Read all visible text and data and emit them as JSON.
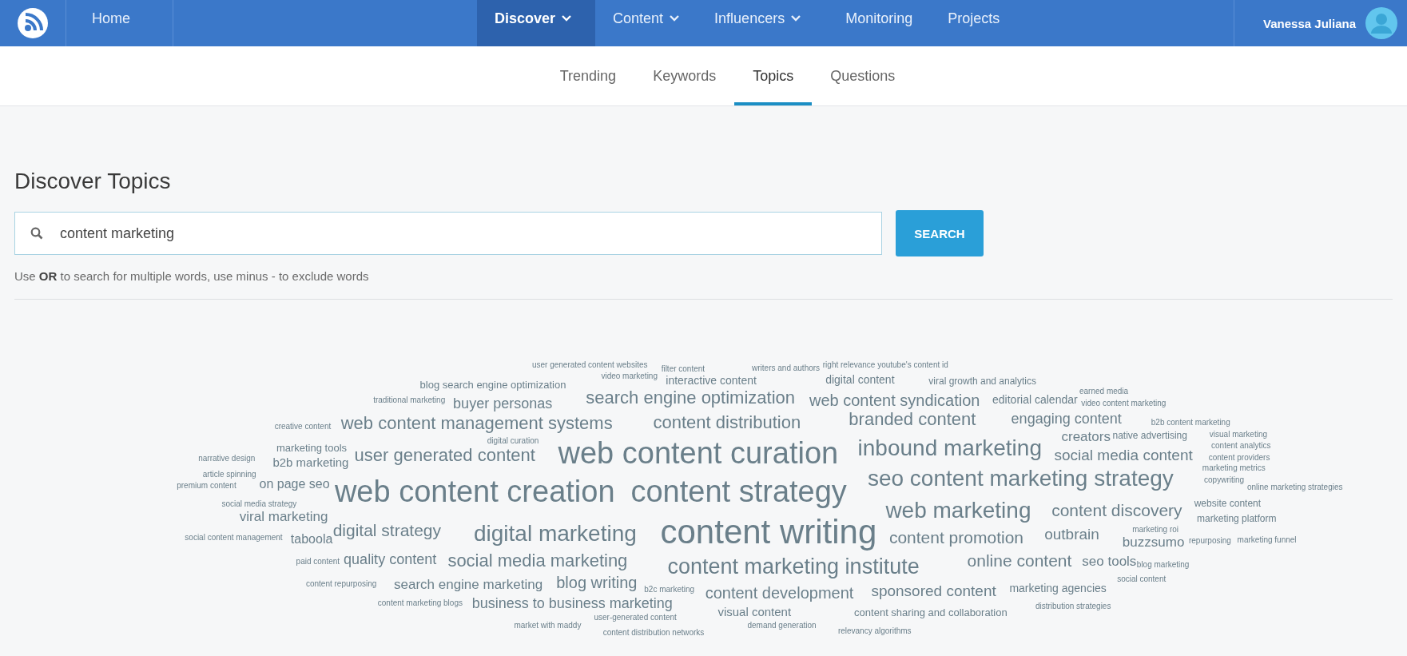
{
  "top_nav": {
    "home": {
      "label": "Home"
    },
    "items": [
      {
        "label": "Discover",
        "selected": true,
        "has_menu": true
      },
      {
        "label": "Content",
        "selected": false,
        "has_menu": true
      },
      {
        "label": "Influencers",
        "selected": false,
        "has_menu": true
      },
      {
        "label": "Monitoring",
        "selected": false,
        "has_menu": false
      },
      {
        "label": "Projects",
        "selected": false,
        "has_menu": false
      }
    ],
    "user": {
      "name": "Vanessa Juliana"
    }
  },
  "tabs": [
    {
      "label": "Trending",
      "selected": false
    },
    {
      "label": "Keywords",
      "selected": false
    },
    {
      "label": "Topics",
      "selected": true
    },
    {
      "label": "Questions",
      "selected": false
    }
  ],
  "page_title": "Discover Topics",
  "search": {
    "value": "content marketing",
    "button": "SEARCH",
    "hint": "Use **OR** to search for multiple words, use minus - to exclude words"
  },
  "word_cloud": {
    "words": [
      "user generated content websites",
      "filter content",
      "writers and authors",
      "right relevance youtube's content id",
      "video marketing",
      "interactive content",
      "digital content",
      "viral growth and analytics",
      "blog search engine optimization",
      "earned media",
      "video content marketing",
      "traditional marketing",
      "buyer personas",
      "search engine optimization",
      "web content syndication",
      "editorial calendar",
      "creative content",
      "web content management systems",
      "content distribution",
      "branded content",
      "engaging content",
      "b2b content marketing",
      "digital curation",
      "creators",
      "native advertising",
      "visual marketing",
      "marketing tools",
      "narrative design",
      "b2b marketing",
      "user generated content",
      "web content curation",
      "inbound marketing",
      "social media content",
      "content analytics",
      "content providers",
      "article spinning",
      "premium content",
      "on page seo",
      "web content creation",
      "content strategy",
      "seo content marketing strategy",
      "marketing metrics",
      "copywriting",
      "online marketing strategies",
      "social media strategy",
      "viral marketing",
      "web marketing",
      "content discovery",
      "website content",
      "marketing platform",
      "social content management",
      "taboola",
      "digital strategy",
      "digital marketing",
      "content writing",
      "content promotion",
      "outbrain",
      "marketing roi",
      "buzzsumo",
      "repurposing",
      "marketing funnel",
      "paid content",
      "quality content",
      "social media marketing",
      "content marketing institute",
      "online content",
      "seo tools",
      "blog marketing",
      "content repurposing",
      "search engine marketing",
      "blog writing",
      "b2c marketing",
      "content development",
      "sponsored content",
      "marketing agencies",
      "social content",
      "content marketing blogs",
      "business to business marketing",
      "user-generated content",
      "visual content",
      "content sharing and collaboration",
      "distribution strategies",
      "market with maddy",
      "content distribution networks",
      "demand generation",
      "relevancy algorithms"
    ]
  }
}
